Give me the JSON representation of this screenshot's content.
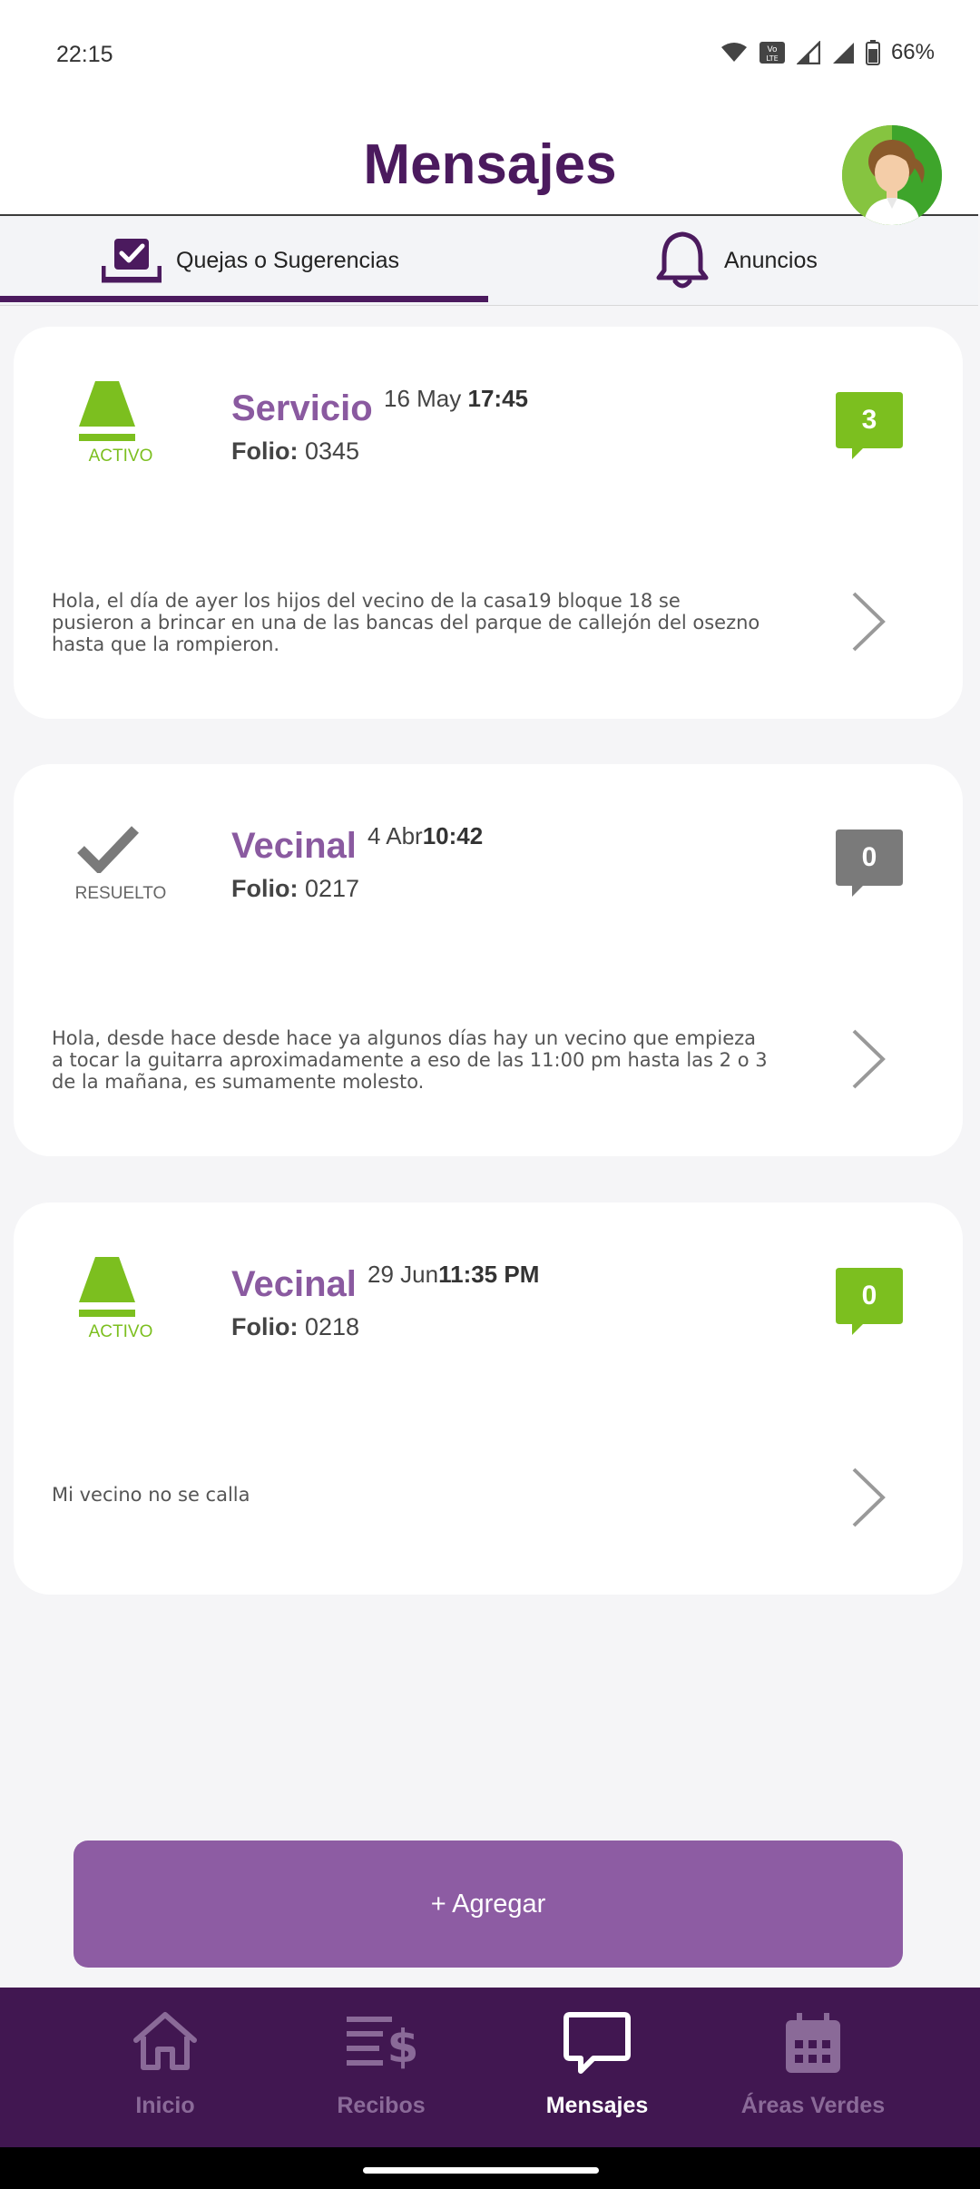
{
  "status_bar": {
    "time": "22:15",
    "battery": "66%"
  },
  "header": {
    "title": "Mensajes"
  },
  "tabs": [
    {
      "label": "Quejas o Sugerencias",
      "active": true
    },
    {
      "label": "Anuncios",
      "active": false
    }
  ],
  "cards": [
    {
      "status": "ACTIVO",
      "category": "Servicio",
      "date": "16 May",
      "time": "17:45",
      "folio_label": "Folio:",
      "folio": "0345",
      "comments": "3",
      "text": "Hola, el día de ayer los hijos del vecino de la casa19 bloque 18 se pusieron a brincar en una de las bancas del parque de callejón del osezno hasta que la rompieron."
    },
    {
      "status": "RESUELTO",
      "category": "Vecinal",
      "date": "4 Abr",
      "time": "10:42",
      "folio_label": "Folio:",
      "folio": "0217",
      "comments": "0",
      "text": "Hola, desde hace desde hace ya algunos días hay un vecino que empieza a tocar la guitarra aproximadamente a eso de las 11:00 pm hasta las 2 o 3 de la mañana, es sumamente molesto."
    },
    {
      "status": "ACTIVO",
      "category": "Vecinal",
      "date": "29 Jun",
      "time": "11:35 PM",
      "folio_label": "Folio:",
      "folio": "0218",
      "comments": "0",
      "text": "Mi vecino no se calla"
    }
  ],
  "add_button": {
    "label": "+ Agregar"
  },
  "nav": [
    {
      "label": "Inicio",
      "icon": "home-icon"
    },
    {
      "label": "Recibos",
      "icon": "receipts-icon"
    },
    {
      "label": "Mensajes",
      "icon": "chat-icon",
      "active": true
    },
    {
      "label": "Áreas Verdes",
      "icon": "calendar-icon"
    }
  ],
  "colors": {
    "primary": "#4b1a5e",
    "accent": "#8d5ca3",
    "active_green": "#7cbf1f",
    "resolved_gray": "#777777",
    "nav_bg": "#411751"
  }
}
